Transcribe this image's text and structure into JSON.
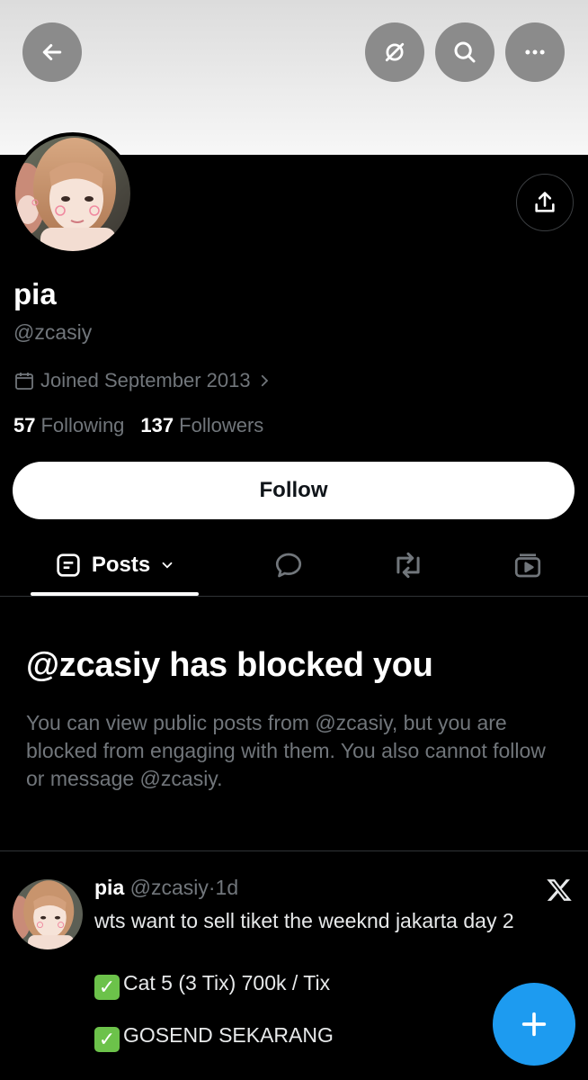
{
  "profile": {
    "display_name": "pia",
    "handle": "@zcasiy",
    "joined": "Joined September 2013",
    "following_count": "57",
    "following_label": "Following",
    "followers_count": "137",
    "followers_label": "Followers"
  },
  "actions": {
    "follow_label": "Follow"
  },
  "tabs": [
    {
      "label": "Posts",
      "icon": "posts-icon"
    },
    {
      "label": "",
      "icon": "reply-icon"
    },
    {
      "label": "",
      "icon": "repost-icon"
    },
    {
      "label": "",
      "icon": "media-icon"
    }
  ],
  "blocked": {
    "title": "@zcasiy has blocked you",
    "message": "You can view public posts from @zcasiy, but you are blocked from engaging with them. You also cannot follow or message @zcasiy."
  },
  "post": {
    "author": "pia",
    "handle": "@zcasiy",
    "separator": "·",
    "time": "1d",
    "line1": "wts want to sell tiket the weeknd jakarta day 2",
    "line2": "Cat 5 (3 Tix) 700k / Tix",
    "line3": "GOSEND SEKARANG"
  },
  "icons": [
    "back-arrow-icon",
    "grok-icon",
    "search-icon",
    "more-icon",
    "share-icon",
    "calendar-icon",
    "chevron-right-icon",
    "chevron-down-icon",
    "x-logo-icon",
    "compose-plus-icon",
    "check-icon"
  ],
  "colors": {
    "accent": "#1d9bf0",
    "muted": "#71767b",
    "background": "#000000",
    "check": "#6cc24a"
  }
}
